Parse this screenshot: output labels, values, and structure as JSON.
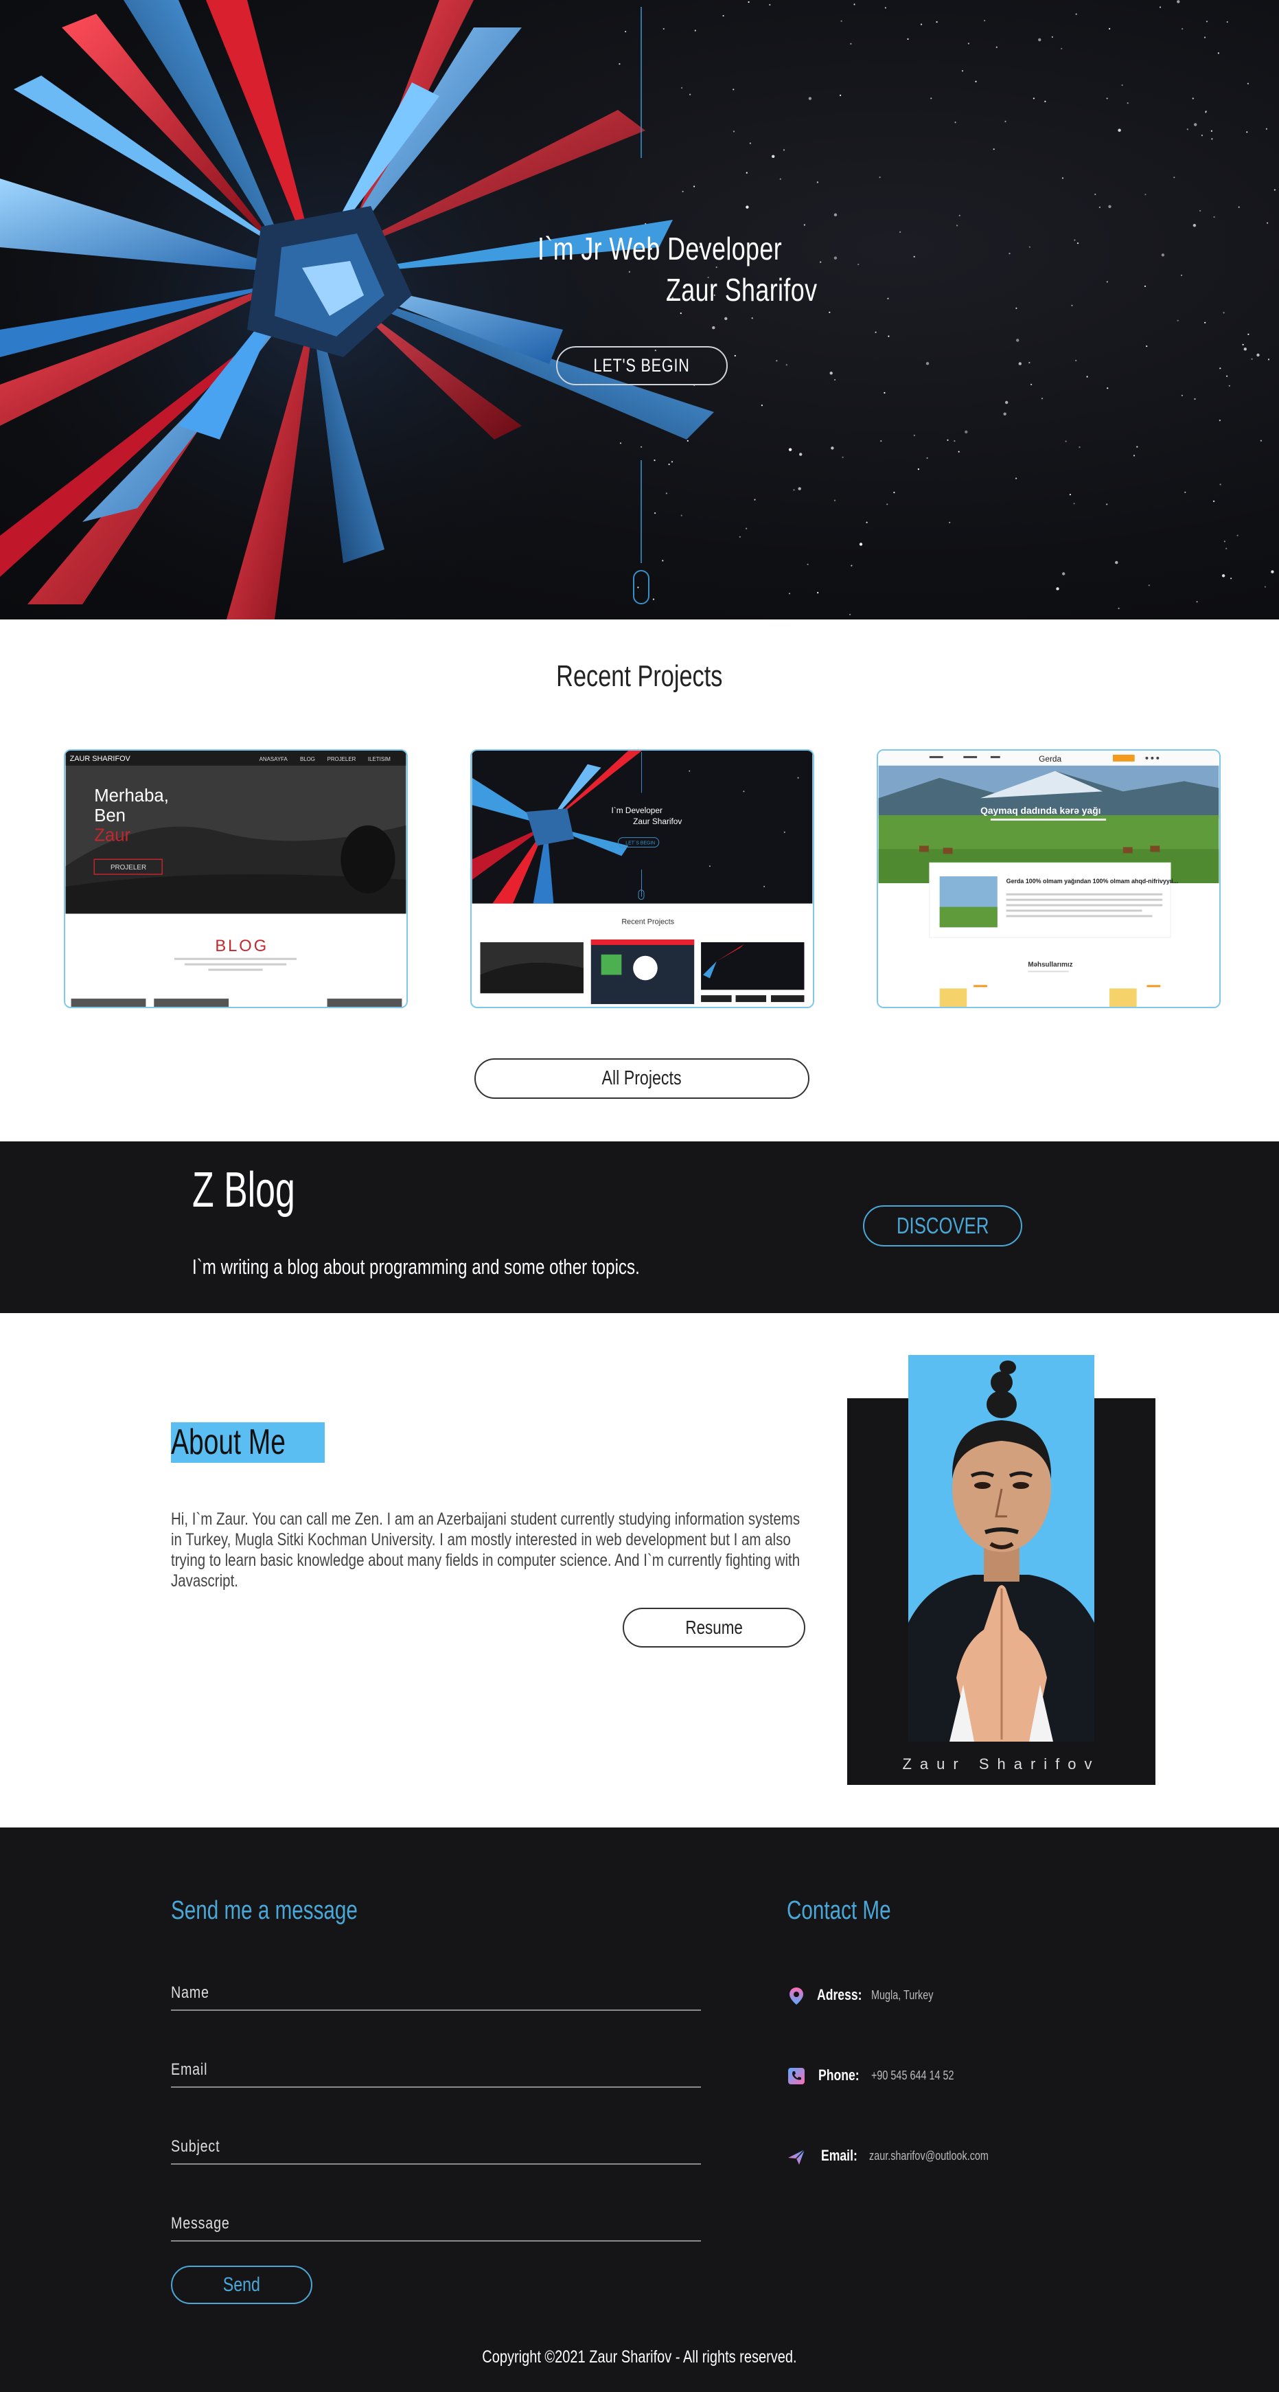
{
  "hero": {
    "line1": "I`m Jr Web Developer",
    "line2": "Zaur Sharifov",
    "cta": "LET'S BEGIN"
  },
  "projects": {
    "title": "Recent Projects",
    "all_label": "All Projects",
    "cards": [
      {
        "logo": "ZAUR SHARIFOV",
        "nav": [
          "ANASAYFA",
          "BLOG",
          "PROJELER",
          "ILETISIM"
        ],
        "greeting_1": "Merhaba,",
        "greeting_2": "Ben",
        "greeting_3": "Zaur",
        "button": "PROJELER",
        "section": "BLOG"
      },
      {
        "line1": "I`m Developer",
        "line2": "Zaur Sharifov",
        "button": "LET`S BEGIN",
        "section": "Recent Projects"
      },
      {
        "brand": "Gerda",
        "headline": "Qaymaq dadında kərə yağı",
        "article": "Gerda 100% olmam yağından 100% olmam ahqd-nifrivyyıi...",
        "section": "Məhsullarımız"
      }
    ]
  },
  "blog": {
    "title": "Z Blog",
    "text": "I`m writing a blog about programming and some other topics.",
    "cta": "DISCOVER"
  },
  "about": {
    "title": "About Me",
    "text": "Hi, I`m Zaur. You can call me Zen. I am an Azerbaijani student currently studying information systems in Turkey, Mugla Sitki Kochman University. I am mostly interested in web development but I am also trying to learn basic knowledge about many fields in computer science. And I`m currently fighting with Javascript.",
    "resume": "Resume",
    "name": "Zaur Sharifov"
  },
  "footer": {
    "message_heading": "Send me a message",
    "fields": [
      "Name",
      "Email",
      "Subject",
      "Message"
    ],
    "send": "Send",
    "contact_heading": "Contact Me",
    "contacts": [
      {
        "label": "Adress:",
        "value": "Mugla, Turkey",
        "icon": "location-pin-icon"
      },
      {
        "label": "Phone:",
        "value": "+90 545 644 14 52",
        "icon": "phone-icon"
      },
      {
        "label": "Email:",
        "value": "zaur.sharifov@outlook.com",
        "icon": "paper-plane-icon"
      }
    ],
    "copyright": "Copyright ©2021 Zaur Sharifov - All rights reserved."
  },
  "colors": {
    "accent": "#4aa8d8",
    "highlight": "#5bbef2",
    "dark": "#151517",
    "hero_red": "#e8212e",
    "hero_blue": "#3f9be0"
  }
}
